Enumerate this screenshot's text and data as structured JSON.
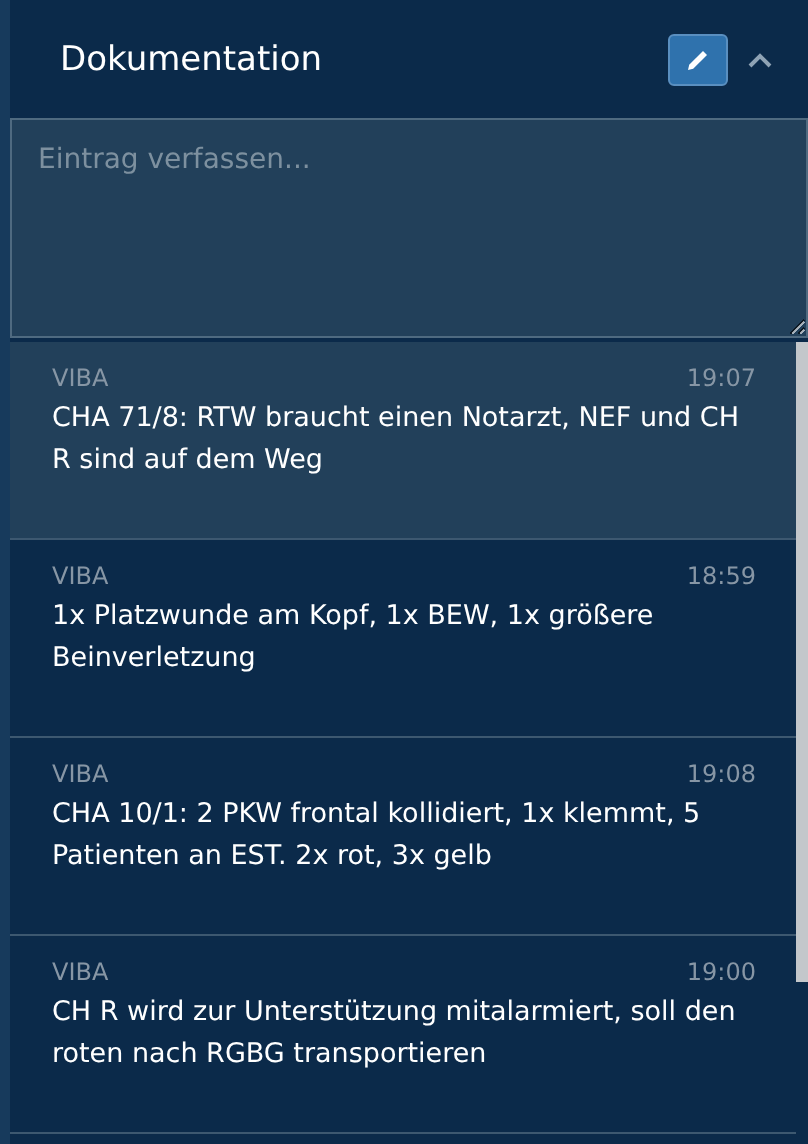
{
  "panel": {
    "title": "Dokumentation",
    "expanded": true
  },
  "composer": {
    "placeholder": "Eintrag verfassen..."
  },
  "entries": [
    {
      "author": "VIBA",
      "time": "19:07",
      "text": "CHA 71/8: RTW braucht einen Notarzt, NEF und CH R sind auf dem Weg",
      "selected": true
    },
    {
      "author": "VIBA",
      "time": "18:59",
      "text": "1x Platzwunde am Kopf, 1x BEW, 1x größere Beinverletzung",
      "selected": false
    },
    {
      "author": "VIBA",
      "time": "19:08",
      "text": "CHA 10/1: 2 PKW frontal kollidiert, 1x klemmt, 5 Patienten an EST. 2x rot, 3x gelb",
      "selected": false
    },
    {
      "author": "VIBA",
      "time": "19:00",
      "text": "CH R wird zur Unterstützung mitalarmiert, soll den roten nach RGBG transportieren",
      "selected": false
    }
  ]
}
